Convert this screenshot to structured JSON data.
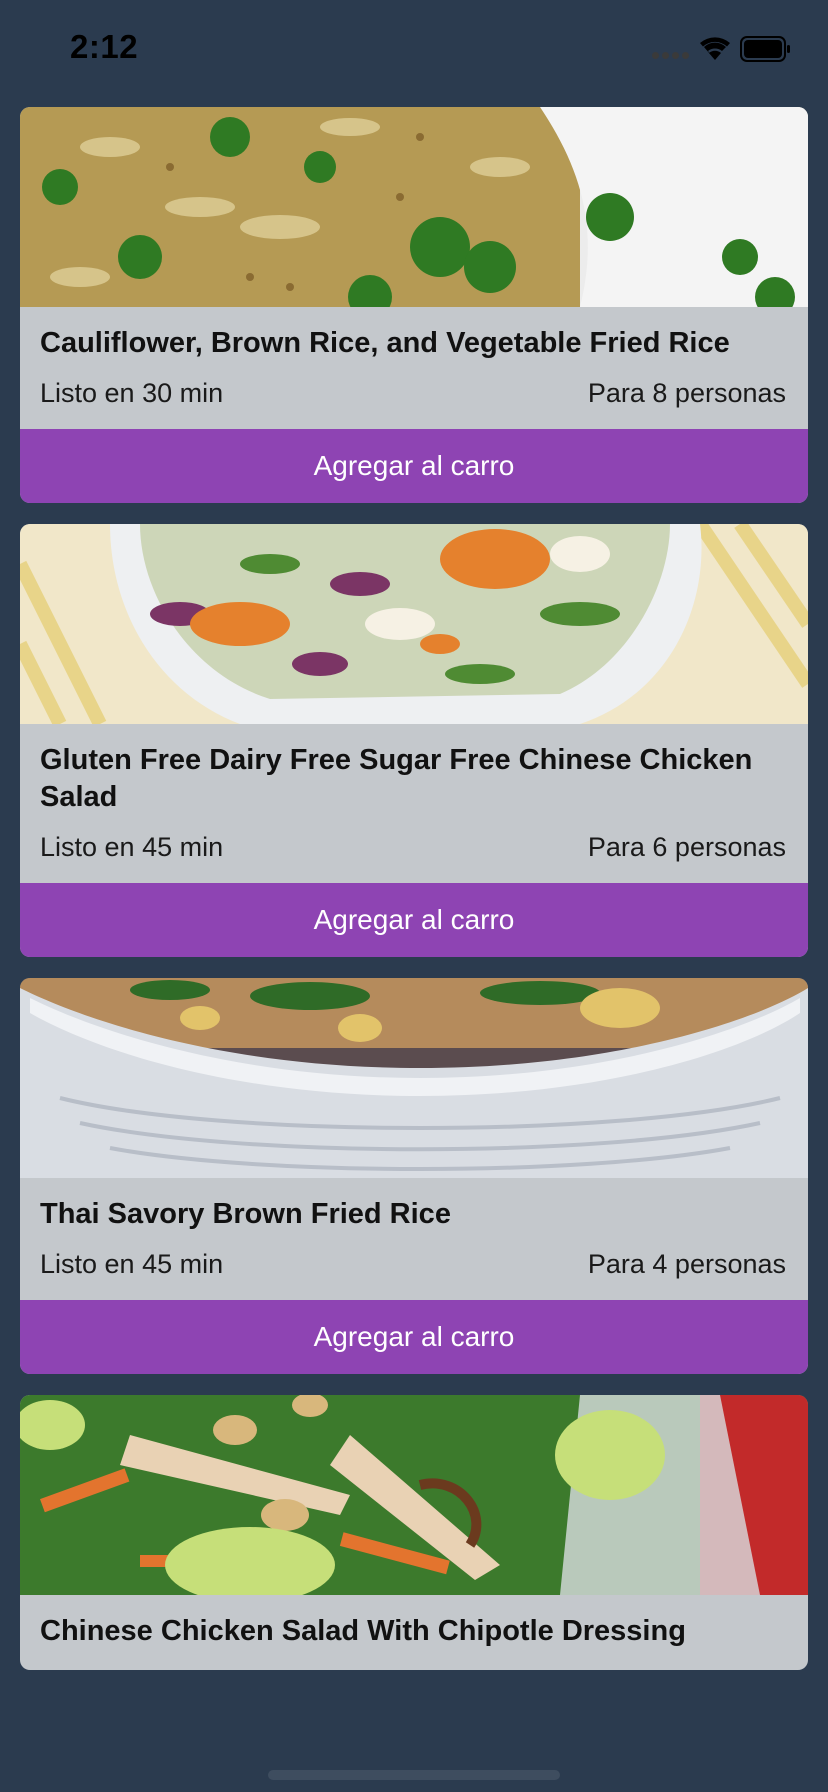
{
  "status": {
    "time": "2:12"
  },
  "recipes": [
    {
      "title": "Cauliflower, Brown Rice, and Vegetable Fried Rice",
      "ready": "Listo en 30 min",
      "servings": "Para 8 personas",
      "button": "Agregar al carro",
      "image": "fried-rice-photo"
    },
    {
      "title": "Gluten Free Dairy Free Sugar Free Chinese Chicken Salad",
      "ready": "Listo en 45 min",
      "servings": "Para 6 personas",
      "button": "Agregar al carro",
      "image": "chicken-salad-bowl-photo"
    },
    {
      "title": "Thai Savory Brown Fried Rice",
      "ready": "Listo en 45 min",
      "servings": "Para 4 personas",
      "button": "Agregar al carro",
      "image": "thai-fried-rice-bowl-photo"
    },
    {
      "title": "Chinese Chicken Salad With Chipotle Dressing",
      "image": "chipotle-chicken-salad-photo"
    }
  ],
  "colors": {
    "background": "#2b3b4f",
    "card": "#c4c8cc",
    "button": "#8e44b3"
  }
}
